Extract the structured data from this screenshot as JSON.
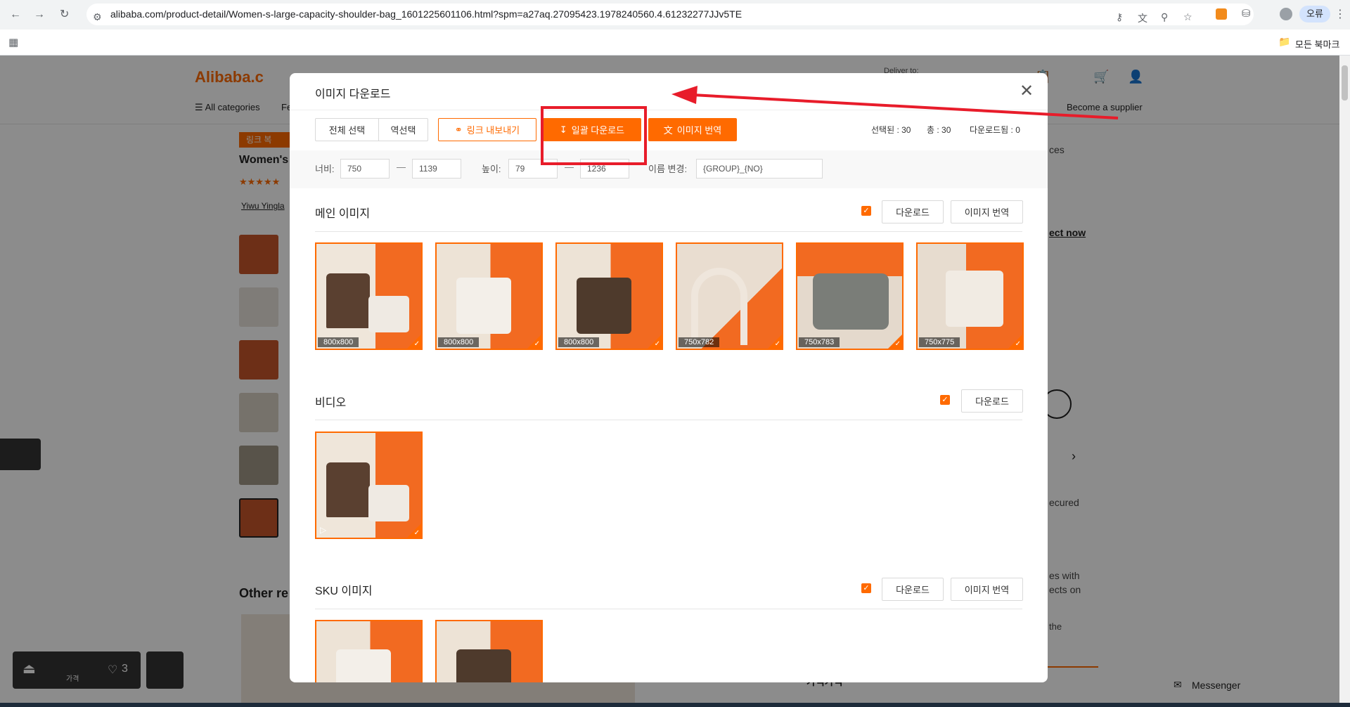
{
  "browser": {
    "url": "alibaba.com/product-detail/Women-s-large-capacity-shoulder-bag_1601225601106.html?spm=a27aq.27095423.1978240560.4.61232277JJv5TE",
    "profile_label": "오류",
    "bookmarks_label": "모든 북마크"
  },
  "site": {
    "logo": "Alibaba.c",
    "deliver_to": "Deliver to:",
    "all_categories": "All categories",
    "nav_partial": "Fe",
    "become_supplier": "Become a supplier",
    "link_tag": "링크 복",
    "product_title": "Women's",
    "seller": "Yiwu Yingla",
    "other_recs": "Other re",
    "right_texts": [
      "ces",
      "ect now",
      "ecured",
      "es with",
      "ects on",
      "the"
    ],
    "bottom_right": "가격가격",
    "price_label": "가격",
    "wish_count": "3",
    "messenger": "Messenger"
  },
  "modal": {
    "title": "이미지 다운로드",
    "toolbar": {
      "select_all": "전체 선택",
      "invert": "역선택",
      "export_links": "링크 내보내기",
      "bulk_download": "일괄 다운로드",
      "translate": "이미지 번역"
    },
    "stats": {
      "selected": "선택된 : 30",
      "total": "총 : 30",
      "downloaded": "다운로드됨 : 0"
    },
    "filters": {
      "width_label": "너비:",
      "width_min": "750",
      "width_max": "1139",
      "height_label": "높이:",
      "height_min": "79",
      "height_max": "1236",
      "rename_label": "이름 변경:",
      "rename_value": "{GROUP}_{NO}"
    },
    "sections": {
      "main": {
        "title": "메인 이미지",
        "download": "다운로드",
        "translate": "이미지 번역",
        "images": [
          "800x800",
          "800x800",
          "800x800",
          "750x782",
          "750x783",
          "750x775"
        ]
      },
      "video": {
        "title": "비디오",
        "download": "다운로드"
      },
      "sku": {
        "title": "SKU 이미지",
        "download": "다운로드",
        "translate": "이미지 번역"
      }
    }
  },
  "colors": {
    "accent": "#ff6a00",
    "annotation": "#e81c2a"
  }
}
